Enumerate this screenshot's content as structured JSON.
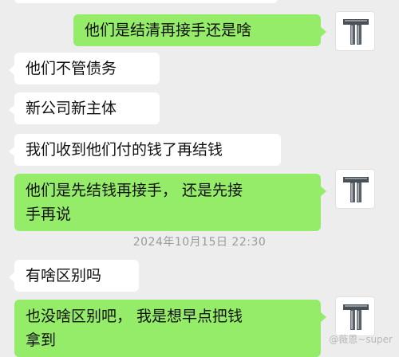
{
  "messages": [
    {
      "side": "out",
      "text": "他们是结清再接手还是啥"
    },
    {
      "side": "in",
      "text": "他们不管债务"
    },
    {
      "side": "in",
      "text": "新公司新主体"
    },
    {
      "side": "in",
      "text": "我们收到他们付的钱了再结钱"
    },
    {
      "side": "out",
      "text": "他们是先结钱再接手， 还是先接\n手再说"
    },
    {
      "side": "in",
      "text": "有啥区别吗"
    },
    {
      "side": "out",
      "text": "也没啥区别吧， 我是想早点把钱\n拿到"
    }
  ],
  "timestamp": "2024年10月15日 22:30",
  "watermark": "@薇恩~super",
  "colors": {
    "background": "#ededed",
    "outgoing_bubble": "#95ec69",
    "incoming_bubble": "#ffffff"
  },
  "avatar": {
    "icon": "steel-beam-t-icon"
  }
}
